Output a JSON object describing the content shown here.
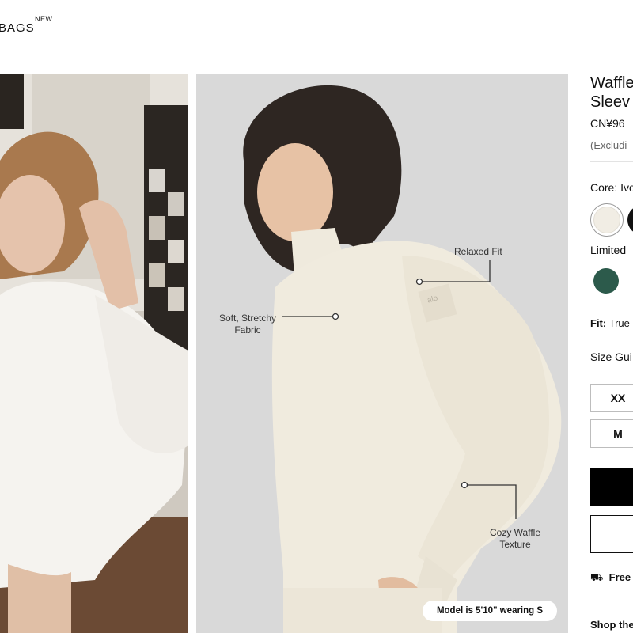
{
  "nav": {
    "bags_label": "BAGS",
    "new_badge": "NEW"
  },
  "gallery": {
    "callouts": {
      "relaxed_fit": "Relaxed Fit",
      "soft_fabric_1": "Soft, Stretchy",
      "soft_fabric_2": "Fabric",
      "cozy_waffle_1": "Cozy Waffle",
      "cozy_waffle_2": "Texture"
    },
    "model_info": "Model is 5'10\" wearing S",
    "sleeve_logo": "alo"
  },
  "product": {
    "title_line1": "Waffle",
    "title_line2": "Sleev",
    "price": "CN¥96",
    "tax_note": "(Excludi",
    "color_label": "Core: Ivo",
    "limited_label": "Limited",
    "fit_label": "Fit:",
    "fit_value": "True",
    "size_guide": "Size Gui",
    "sizes": [
      "XX",
      "M"
    ],
    "shipping": "Free",
    "shop_the": "Shop the",
    "colors": {
      "ivory": "#f1ede4",
      "black": "#111111",
      "green": "#2c5a4b"
    }
  }
}
